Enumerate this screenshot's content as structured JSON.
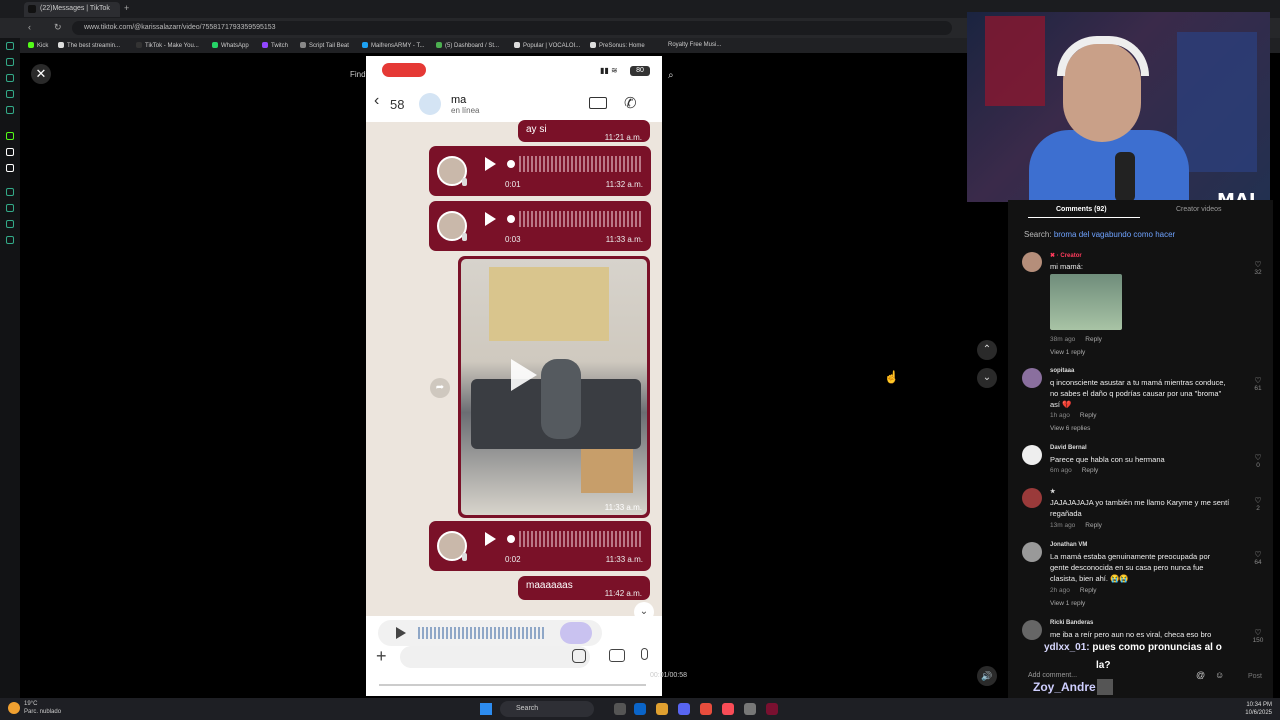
{
  "browser": {
    "tab_title": "(22)Messages | TikTok",
    "url": "www.tiktok.com/@karissalazarr/video/7558171793359595153",
    "bookmarks": [
      "Kick",
      "The best streamin...",
      "TikTok - Make You...",
      "WhatsApp",
      "Twitch",
      "Script Tail Beat",
      "MaifrensARMY - T...",
      "(5) Dashboard / St...",
      "Popular | VOCALOI...",
      "PreSonus: Home",
      "Royalty Free Musi..."
    ]
  },
  "viewer": {
    "find_related": "Find related content",
    "close_icon": "✕",
    "progress_time": "00:01/00:58",
    "progress_fraction": 0.02
  },
  "phone": {
    "battery": "80",
    "back_count": "58",
    "contact_name": "ma",
    "contact_status": "en línea",
    "messages": {
      "m1": {
        "text": "ay si",
        "time": "11:21 a.m."
      },
      "v1": {
        "duration": "0:01",
        "time": "11:32 a.m."
      },
      "v2": {
        "duration": "0:03",
        "time": "11:33 a.m."
      },
      "photo_time": "11:33 a.m.",
      "v3": {
        "duration": "0:02",
        "time": "11:33 a.m."
      },
      "m2": {
        "text": "maaaaaas",
        "time": "11:42 a.m."
      }
    }
  },
  "webcam": {
    "logo": "MAI"
  },
  "comments": {
    "tab_comments": "Comments (92)",
    "tab_creator": "Creator videos",
    "search_prefix": "Search:",
    "search_query": "broma del vagabundo como hacer",
    "items": [
      {
        "user": "✖ · Creator",
        "text": "mi mamá:",
        "meta": "38m ago",
        "reply": "Reply",
        "view": "View 1 reply",
        "likes": "32"
      },
      {
        "user": "sopitaaa",
        "text": "q inconsciente asustar a tu mamá mientras conduce, no sabes el daño q podrías causar por una \"broma\" así 💔",
        "meta": "1h ago",
        "reply": "Reply",
        "view": "View 6 replies",
        "likes": "61"
      },
      {
        "user": "David Bernal",
        "text": "Parece que habla con su hermana",
        "meta": "6m ago",
        "reply": "Reply",
        "view": "",
        "likes": "0"
      },
      {
        "user": "★",
        "text": "JAJAJAJAJA yo también me llamo Karyme y me sentí regañada",
        "meta": "13m ago",
        "reply": "Reply",
        "view": "",
        "likes": "2"
      },
      {
        "user": "Jonathan VM",
        "text": "La mamá estaba genuinamente preocupada por gente desconocida en su casa pero nunca fue clasista, bien ahí. 😭😭",
        "meta": "2h ago",
        "reply": "Reply",
        "view": "View 1 reply",
        "likes": "64"
      },
      {
        "user": "Ricki Banderas",
        "text": "me iba a reír pero aun no es viral, checa eso bro",
        "meta": "",
        "reply": "",
        "view": "",
        "likes": "150"
      }
    ],
    "add_comment": "Add comment...",
    "post": "Post"
  },
  "stream_overlay": {
    "line1_user": "ydlxx_01:",
    "line1_text": "pues como pronuncias al o",
    "line1b": "la?",
    "line2": "Zoy_Andre"
  },
  "taskbar": {
    "weather_temp": "19°C",
    "weather_text": "Parc. nublado",
    "search": "Search",
    "time": "10:34 PM",
    "date": "10/6/2025"
  }
}
